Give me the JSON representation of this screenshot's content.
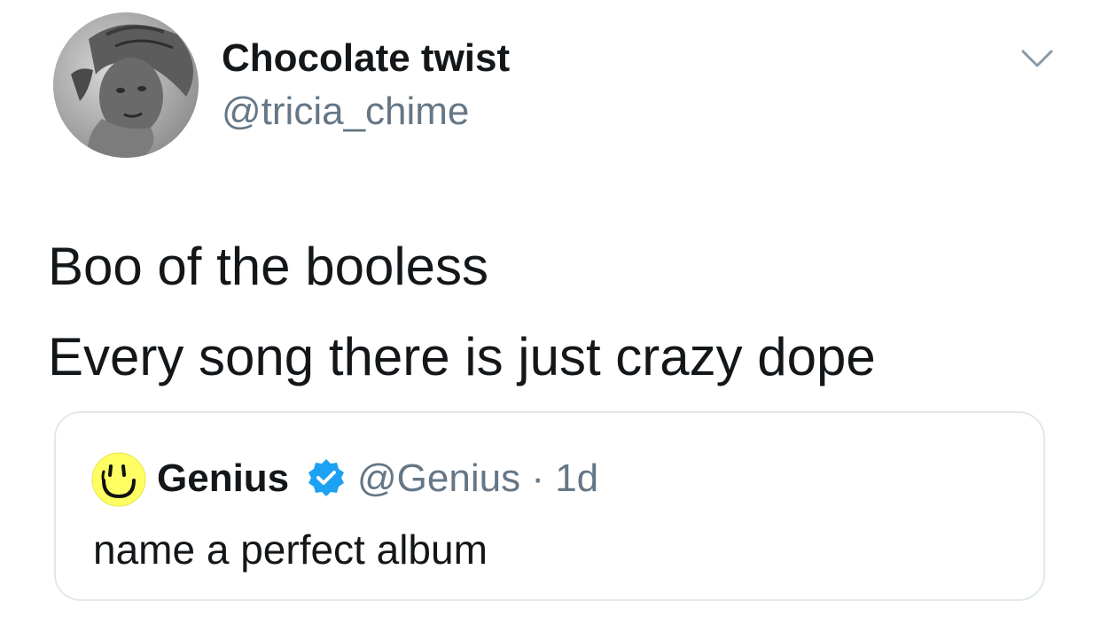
{
  "author": {
    "display_name": "Chocolate twist",
    "handle": "@tricia_chime",
    "avatar_icon": "user-avatar"
  },
  "menu_icon": "chevron-down-icon",
  "tweet": {
    "lines": [
      "Boo of the booless",
      "Every song there is just crazy dope"
    ]
  },
  "quoted_tweet": {
    "avatar_icon": "genius-smiley-avatar",
    "display_name": "Genius",
    "verified_icon": "verified-badge-icon",
    "handle": "@Genius",
    "separator": "·",
    "time": "1d",
    "text": "name a perfect album"
  },
  "colors": {
    "text_primary": "#14171a",
    "text_secondary": "#657786",
    "border": "#e1e8ed",
    "verified_blue": "#1da1f2",
    "genius_yellow": "#ffff64"
  }
}
